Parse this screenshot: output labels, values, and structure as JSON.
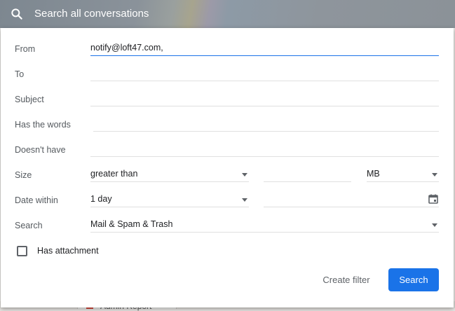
{
  "search_bar": {
    "placeholder": "Search all conversations",
    "icon": "search-icon"
  },
  "background": {
    "item_label": "Admin Report"
  },
  "form": {
    "from": {
      "label": "From",
      "value": "notify@loft47.com,"
    },
    "to": {
      "label": "To",
      "value": ""
    },
    "subject": {
      "label": "Subject",
      "value": ""
    },
    "has_words": {
      "label": "Has the words",
      "value": ""
    },
    "doesnt_have": {
      "label": "Doesn't have",
      "value": ""
    },
    "size": {
      "label": "Size",
      "operator": "greater than",
      "value": "",
      "unit": "MB"
    },
    "date_within": {
      "label": "Date within",
      "value": "1 day",
      "date": ""
    },
    "search_in": {
      "label": "Search",
      "value": "Mail & Spam & Trash"
    },
    "has_attachment": {
      "label": "Has attachment",
      "checked": false
    }
  },
  "actions": {
    "create_filter": "Create filter",
    "search": "Search"
  },
  "colors": {
    "accent": "#1a73e8",
    "label": "#555a5f",
    "text": "#202124"
  }
}
